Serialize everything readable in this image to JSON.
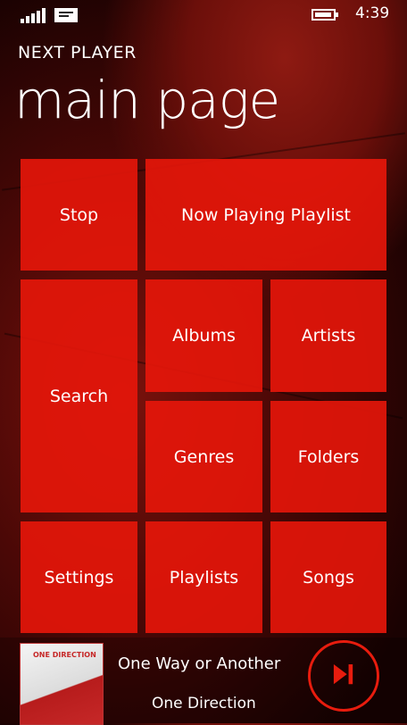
{
  "status_bar": {
    "time": "4:39",
    "icons": [
      "signal-icon",
      "message-icon",
      "battery-icon"
    ]
  },
  "header": {
    "app_title": "NEXT PLAYER",
    "page_title": "main page"
  },
  "tiles": {
    "stop": "Stop",
    "now_playing_playlist": "Now Playing Playlist",
    "search": "Search",
    "albums": "Albums",
    "artists": "Artists",
    "genres": "Genres",
    "folders": "Folders",
    "settings": "Settings",
    "playlists": "Playlists",
    "songs": "Songs"
  },
  "now_playing": {
    "song": "One Way or Another",
    "artist": "One Direction",
    "album_art_text": "ONE DIRECTION"
  },
  "colors": {
    "accent": "#e8160a",
    "background": "#1a0303"
  }
}
